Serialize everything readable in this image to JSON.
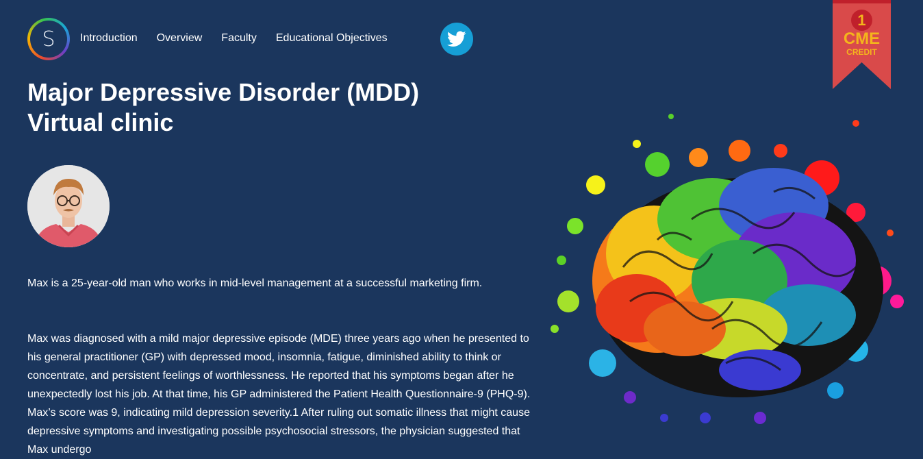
{
  "header": {
    "logo_letter": "S",
    "nav": [
      {
        "label": "Introduction"
      },
      {
        "label": "Overview"
      },
      {
        "label": "Faculty"
      },
      {
        "label": "Educational Objectives"
      }
    ],
    "social_icon": "twitter-icon"
  },
  "badge": {
    "number": "1",
    "label": "CME",
    "sublabel": "CREDIT"
  },
  "main": {
    "title_line1": "Major Depressive Disorder (MDD)",
    "title_line2": "Virtual clinic",
    "paragraph1": "Max is a 25-year-old man who works in mid-level management at a successful marketing firm.",
    "paragraph2": "Max was diagnosed with a mild major depressive episode (MDE) three years ago when he presented to his general practitioner (GP) with depressed mood, insomnia, fatigue, diminished ability to think or concentrate, and persistent feelings of worthlessness. He reported that his symptoms began after he unexpectedly lost his job. At that time, his GP administered the Patient Health Questionnaire-9 (PHQ-9). Max’s score was 9, indicating mild depression severity.1 After ruling out somatic illness that might cause depressive symptoms and investigating possible psychosocial stressors, the physician suggested that Max undergo"
  },
  "colors": {
    "background": "#1b365d",
    "ribbon": "#d94a4a",
    "ribbon_text": "#f4b51c",
    "twitter": "#169fd6"
  }
}
